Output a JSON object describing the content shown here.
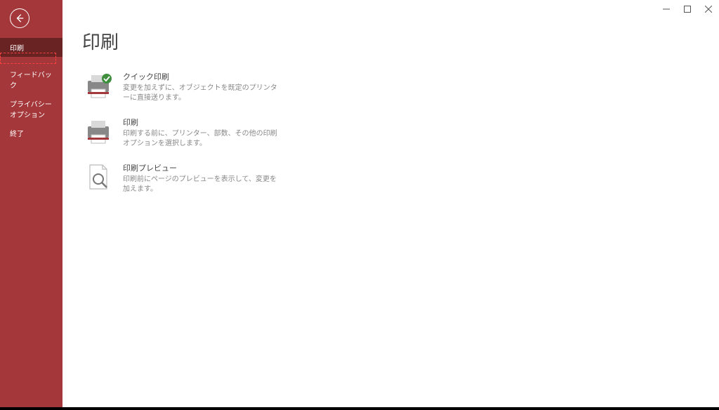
{
  "titlebar": {
    "minimize": "minimize",
    "maximize": "maximize",
    "close": "close"
  },
  "sidebar": {
    "items": [
      {
        "label": "印刷"
      },
      {
        "label": "フィードバック"
      },
      {
        "label": "プライバシー オプション"
      },
      {
        "label": "終了"
      }
    ]
  },
  "page": {
    "title": "印刷",
    "options": [
      {
        "title": "クイック印刷",
        "desc": "変更を加えずに、オブジェクトを既定のプリンターに直接送ります。"
      },
      {
        "title": "印刷",
        "desc": "印刷する前に、プリンター、部数、その他の印刷オプションを選択します。"
      },
      {
        "title": "印刷プレビュー",
        "desc": "印刷前にページのプレビューを表示して、変更を加えます。"
      }
    ]
  }
}
